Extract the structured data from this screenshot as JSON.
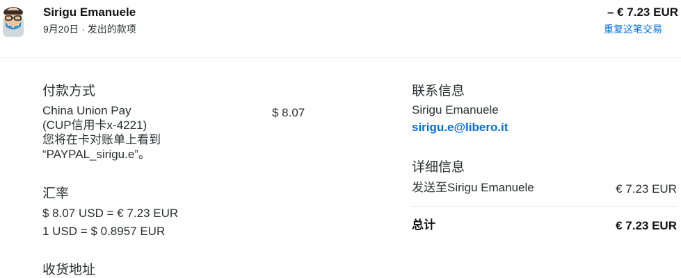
{
  "header": {
    "name": "Sirigu Emanuele",
    "subtitle": "9月20日 · 发出的款项",
    "amount": "– € 7.23 EUR",
    "repeat_link": "重复这笔交易"
  },
  "payment": {
    "title": "付款方式",
    "method_line1": "China Union Pay",
    "method_line2": "(CUP信用卡x-4221)",
    "method_line3": "您将在卡对账单上看到",
    "method_line4": "“PAYPAL_sirigu.e”。",
    "amount": "$ 8.07"
  },
  "exchange": {
    "title": "汇率",
    "line1": "$ 8.07 USD = € 7.23 EUR",
    "line2": "1 USD = $ 0.8957 EUR"
  },
  "shipping": {
    "title": "收货地址"
  },
  "contact": {
    "title": "联系信息",
    "name": "Sirigu Emanuele",
    "email": "sirigu.e@libero.it"
  },
  "details": {
    "title": "详细信息",
    "sent_to_label": "发送至Sirigu Emanuele",
    "sent_to_amount": "€ 7.23 EUR",
    "total_label": "总计",
    "total_amount": "€ 7.23 EUR"
  },
  "colors": {
    "link": "#0070e0",
    "text": "#2c2e2f"
  }
}
